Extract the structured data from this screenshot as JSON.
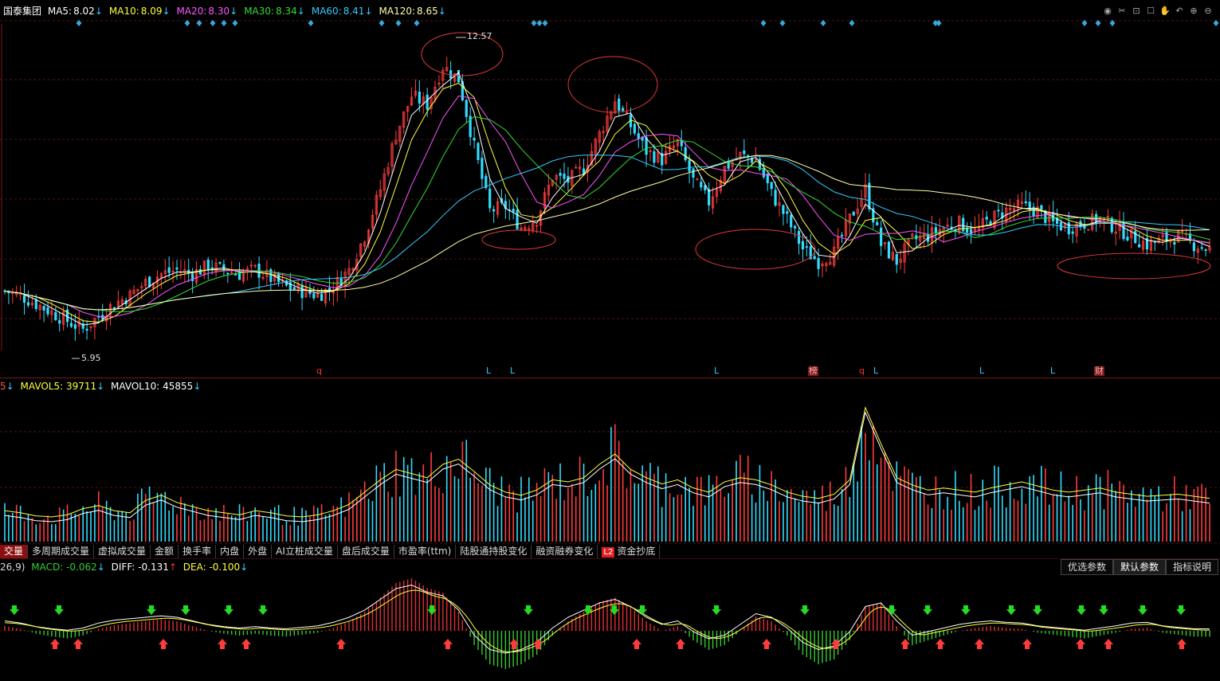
{
  "price": {
    "stock_name": "国泰集团",
    "ma": [
      {
        "label": "MA5:",
        "value": "8.02",
        "color": "#ffffff"
      },
      {
        "label": "MA10:",
        "value": "8.09",
        "color": "#ffff3c"
      },
      {
        "label": "MA20:",
        "value": "8.30",
        "color": "#ff55ff"
      },
      {
        "label": "MA30:",
        "value": "8.34",
        "color": "#33dd33"
      },
      {
        "label": "MA60:",
        "value": "8.41",
        "color": "#33ccff"
      },
      {
        "label": "MA120:",
        "value": "8.65",
        "color": "#ffffaa"
      }
    ],
    "arrow": "↓",
    "high_label": "12.57",
    "low_label": "5.95",
    "markers": [
      {
        "text": "q",
        "color": "#ff3030"
      },
      {
        "text": "L",
        "color": "#33ccff"
      },
      {
        "text": "L",
        "color": "#33ccff"
      },
      {
        "text": "L",
        "color": "#33ccff"
      },
      {
        "text": "榜",
        "color": "#ff8080"
      },
      {
        "text": "q",
        "color": "#ff3030"
      },
      {
        "text": "L",
        "color": "#33ccff"
      },
      {
        "text": "L",
        "color": "#33ccff"
      },
      {
        "text": "L",
        "color": "#33ccff"
      },
      {
        "text": "财",
        "color": "#ff8080"
      }
    ]
  },
  "volume": {
    "prefix": "5",
    "mavol5_label": "MAVOL5:",
    "mavol5_value": "39711",
    "mavol10_label": "MAVOL10:",
    "mavol10_value": "45855",
    "arrow": "↓"
  },
  "tabs": [
    {
      "label": "交量",
      "active": true
    },
    {
      "label": "多周期成交量"
    },
    {
      "label": "虚拟成交量"
    },
    {
      "label": "金额"
    },
    {
      "label": "换手率"
    },
    {
      "label": "内盘"
    },
    {
      "label": "外盘"
    },
    {
      "label": "AI立桩成交量"
    },
    {
      "label": "盘后成交量"
    },
    {
      "label": "市盈率(ttm)"
    },
    {
      "label": "陆股通持股变化"
    },
    {
      "label": "融资融券变化"
    },
    {
      "label": "资金抄底",
      "badge": "L2"
    }
  ],
  "macd": {
    "prefix": "26,9)",
    "macd_label": "MACD:",
    "macd_value": "-0.062",
    "macd_arrow": "↓",
    "diff_label": "DIFF:",
    "diff_value": "-0.131",
    "diff_arrow": "↑",
    "dea_label": "DEA:",
    "dea_value": "-0.100",
    "dea_arrow": "↓"
  },
  "param_buttons": [
    "优选参数",
    "默认参数",
    "指标说明"
  ],
  "toolbar_icons": [
    "eye-icon",
    "scissors-icon",
    "lock-icon",
    "square-icon",
    "hand-icon",
    "undo-icon",
    "zoom-in-icon",
    "zoom-out-icon"
  ],
  "colors": {
    "up": "#ff3c3c",
    "down": "#33ddff",
    "grid": "#4a1616",
    "macd_pos": "#e03030",
    "macd_neg": "#33cc33"
  },
  "chart_data": [
    {
      "type": "candlestick",
      "title": "国泰集团",
      "ylim": [
        5.5,
        13.2
      ],
      "high": 12.57,
      "low": 5.95,
      "moving_averages": {
        "MA5": 8.02,
        "MA10": 8.09,
        "MA20": 8.3,
        "MA30": 8.34,
        "MA60": 8.41,
        "MA120": 8.65
      },
      "close_series": [
        6.9,
        6.8,
        6.6,
        6.4,
        6.2,
        6.0,
        6.3,
        6.6,
        6.8,
        7.1,
        7.3,
        7.4,
        7.3,
        7.5,
        7.4,
        7.3,
        7.4,
        7.2,
        7.0,
        6.9,
        6.8,
        7.0,
        7.4,
        8.2,
        9.3,
        10.6,
        11.5,
        11.3,
        12.2,
        11.9,
        10.3,
        8.8,
        8.9,
        8.4,
        8.6,
        9.6,
        9.5,
        9.8,
        10.6,
        11.4,
        10.8,
        10.2,
        10.0,
        10.4,
        9.5,
        9.0,
        9.8,
        10.1,
        10.0,
        9.2,
        8.6,
        7.9,
        7.6,
        7.8,
        8.6,
        9.3,
        8.0,
        7.6,
        8.1,
        8.2,
        8.4,
        8.5,
        8.3,
        8.6,
        8.8,
        8.9,
        8.8,
        8.5,
        8.4,
        8.5,
        8.6,
        8.4,
        8.2,
        8.0,
        8.1,
        8.2,
        8.0,
        7.9
      ],
      "annotations": [
        "q",
        "L",
        "L",
        "L",
        "榜",
        "q",
        "L",
        "L",
        "L",
        "财"
      ]
    },
    {
      "type": "bar",
      "title": "VOL",
      "series": [
        {
          "name": "MAVOL5",
          "last": 39711
        },
        {
          "name": "MAVOL10",
          "last": 45855
        }
      ],
      "values": [
        30,
        28,
        25,
        24,
        26,
        32,
        35,
        30,
        28,
        40,
        45,
        38,
        34,
        30,
        28,
        26,
        30,
        28,
        25,
        24,
        26,
        30,
        36,
        48,
        60,
        70,
        66,
        62,
        75,
        80,
        68,
        55,
        48,
        45,
        50,
        60,
        58,
        62,
        75,
        85,
        70,
        62,
        56,
        60,
        52,
        48,
        58,
        62,
        60,
        55,
        48,
        44,
        42,
        46,
        60,
        130,
        95,
        62,
        55,
        50,
        52,
        50,
        48,
        52,
        55,
        58,
        54,
        50,
        48,
        50,
        52,
        48,
        46,
        44,
        45,
        46,
        44,
        42
      ]
    },
    {
      "type": "bar",
      "title": "MACD",
      "series": [
        {
          "name": "MACD",
          "last": -0.062
        },
        {
          "name": "DIFF",
          "last": -0.131
        },
        {
          "name": "DEA",
          "last": -0.1
        }
      ],
      "values": [
        0.05,
        0.02,
        -0.03,
        -0.06,
        -0.08,
        -0.05,
        0.02,
        0.06,
        0.08,
        0.1,
        0.12,
        0.1,
        0.05,
        0.0,
        -0.03,
        -0.05,
        -0.03,
        -0.05,
        -0.06,
        -0.04,
        -0.02,
        0.03,
        0.1,
        0.2,
        0.35,
        0.5,
        0.55,
        0.45,
        0.4,
        0.2,
        -0.15,
        -0.35,
        -0.4,
        -0.35,
        -0.25,
        -0.05,
        0.1,
        0.2,
        0.3,
        0.35,
        0.25,
        0.1,
        0.0,
        0.05,
        -0.1,
        -0.2,
        -0.15,
        0.0,
        0.15,
        0.1,
        -0.05,
        -0.25,
        -0.35,
        -0.3,
        -0.1,
        0.25,
        0.3,
        0.05,
        -0.15,
        -0.1,
        -0.05,
        0.0,
        0.03,
        0.05,
        0.03,
        0.02,
        -0.02,
        -0.04,
        -0.06,
        -0.08,
        -0.05,
        -0.02,
        0.02,
        0.03,
        -0.02,
        -0.04,
        -0.06,
        -0.062
      ]
    }
  ]
}
